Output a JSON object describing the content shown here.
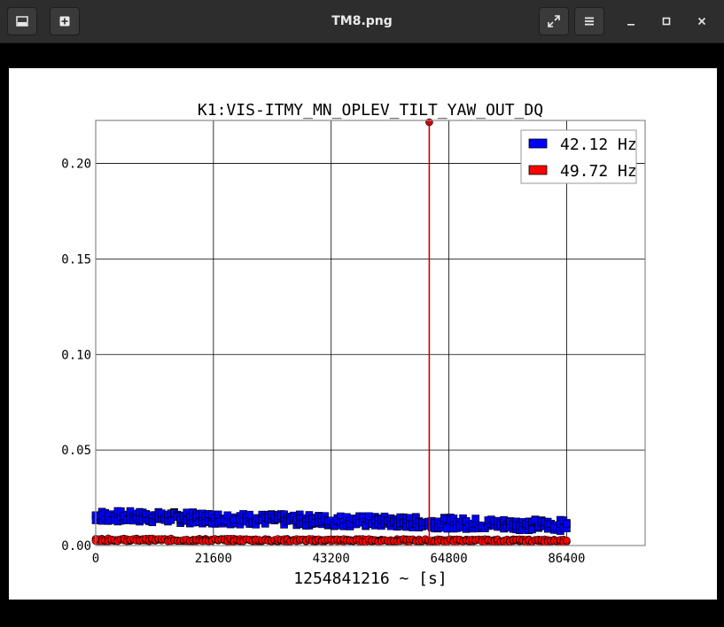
{
  "window": {
    "title": "TM8.png",
    "buttons": {
      "open": "image-icon",
      "new": "plus-icon",
      "fullscreen": "expand-icon",
      "menu": "hamburger-icon",
      "minimize": "minimize-icon",
      "maximize": "maximize-icon",
      "close": "close-icon"
    }
  },
  "colors": {
    "series1": "#0000ff",
    "series2": "#ff0000",
    "marker": "#cc0000",
    "titlebar": "#2d2d2d"
  },
  "chart_data": {
    "type": "scatter",
    "title": "K1:VIS-ITMY_MN_OPLEV_TILT_YAW_OUT_DQ",
    "xlabel": "1254841216 ~ [s]",
    "ylabel": "",
    "xlim": [
      0,
      100800
    ],
    "ylim": [
      0,
      0.2225
    ],
    "xticks": [
      "0",
      "21600",
      "43200",
      "64800",
      "86400"
    ],
    "yticks": [
      "0.00",
      "0.05",
      "0.10",
      "0.15",
      "0.20"
    ],
    "grid": true,
    "legend_position": "top-right",
    "series": [
      {
        "name": "42.12 Hz",
        "color": "#0000ff",
        "marker": "square",
        "x_range": [
          0,
          86400
        ],
        "y_start": 0.0155,
        "y_end": 0.0105,
        "spread": 0.006
      },
      {
        "name": "49.72 Hz",
        "color": "#ff0000",
        "marker": "circle",
        "x_range": [
          0,
          86400
        ],
        "y_start": 0.003,
        "y_end": 0.0025,
        "spread": 0.0015,
        "spike": {
          "x": 61200,
          "y": 0.2225
        }
      }
    ]
  }
}
